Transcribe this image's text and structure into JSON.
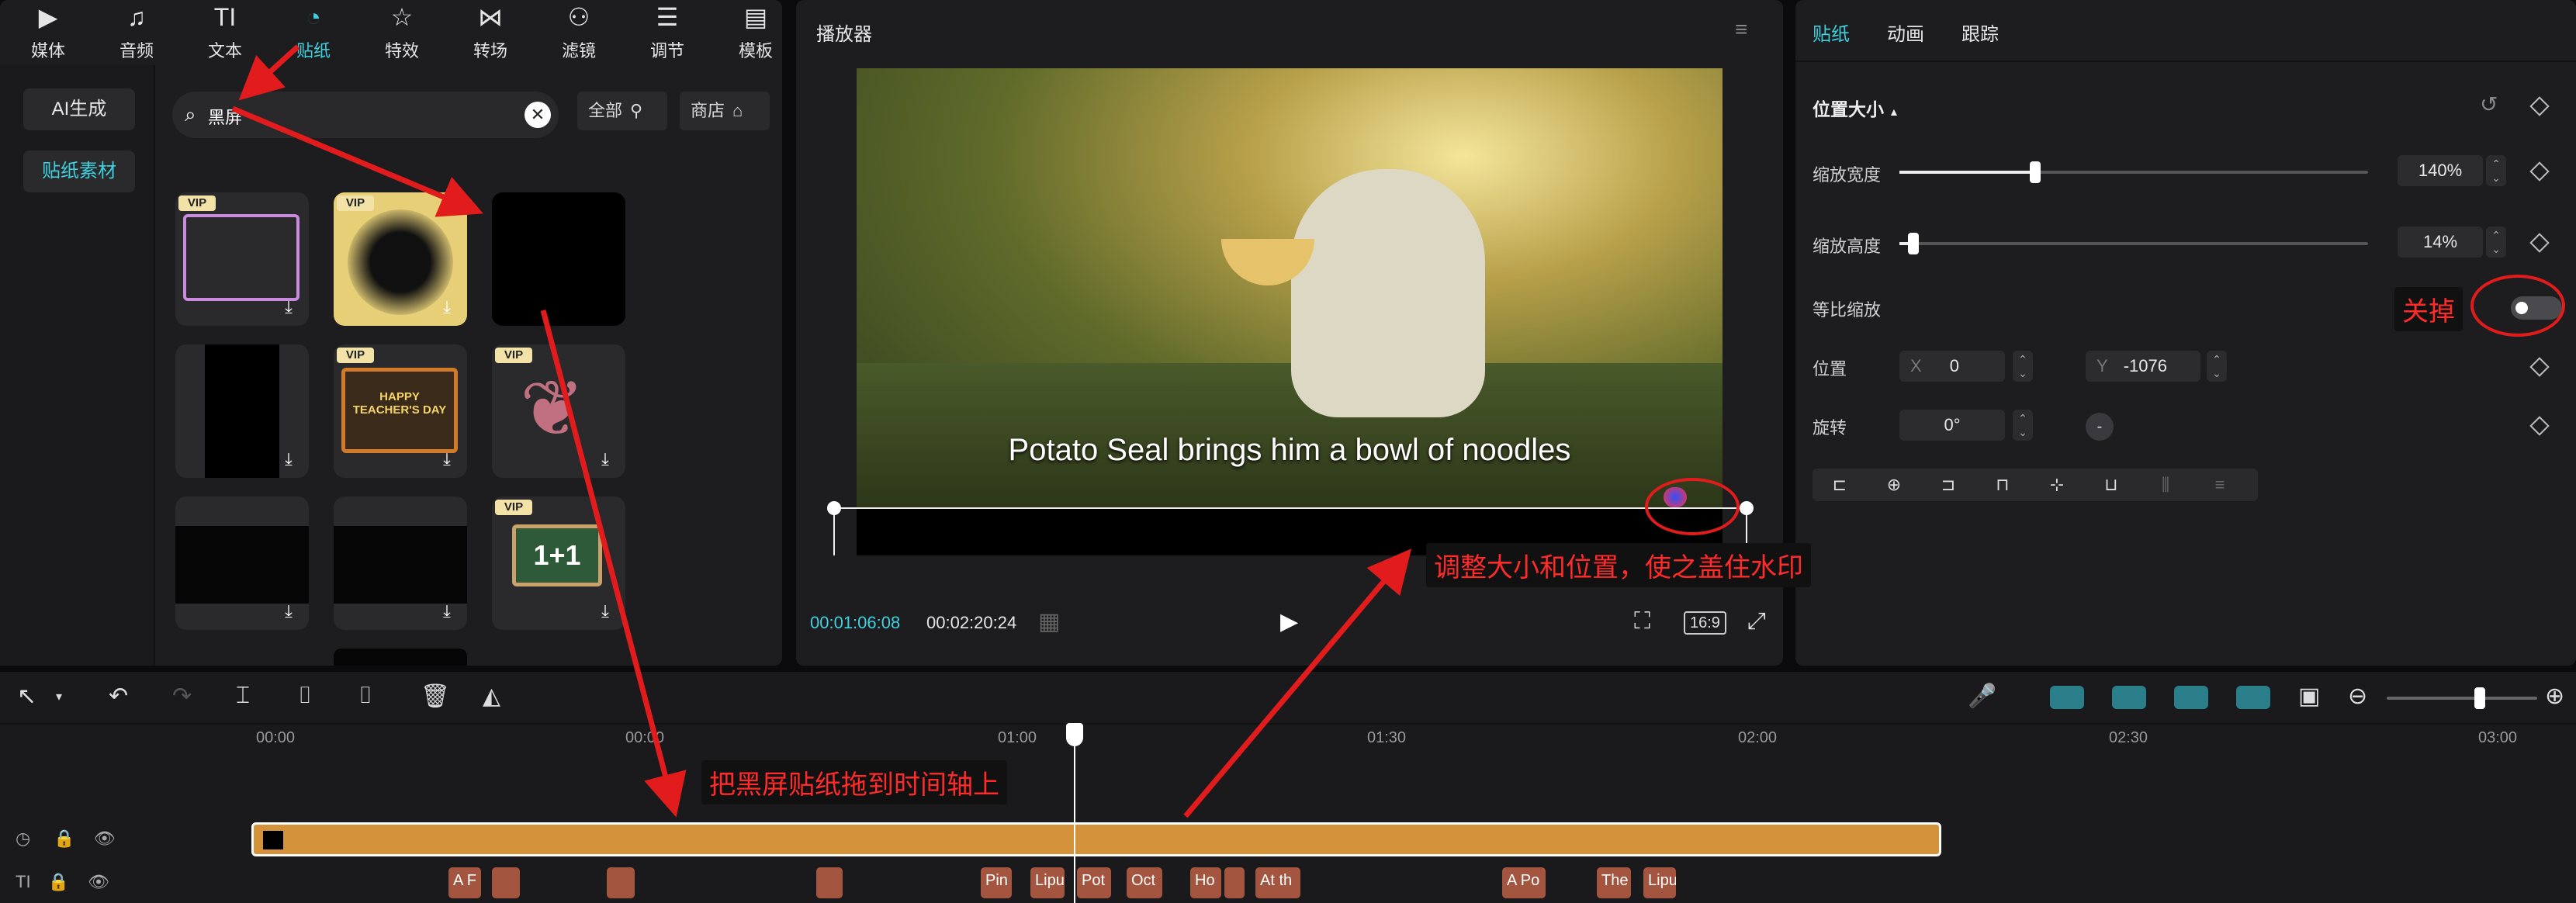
{
  "menu": [
    "媒体",
    "音频",
    "文本",
    "贴纸",
    "特效",
    "转场",
    "滤镜",
    "调节",
    "模板"
  ],
  "menu_icons": [
    "media-icon",
    "audio-icon",
    "text-icon",
    "sticker-icon",
    "effect-icon",
    "transition-icon",
    "filter-icon",
    "adjust-icon",
    "template-icon"
  ],
  "sidebar": {
    "ai_gen": "AI生成",
    "sticker_material": "贴纸素材"
  },
  "search": {
    "value": "黑屏"
  },
  "filter": {
    "all": "全部",
    "store": "商店"
  },
  "stickers": {
    "vip": "VIP",
    "happy_teachers": "HAPPY TEACHER'S DAY",
    "math": "1+1"
  },
  "player": {
    "title": "播放器",
    "subtitle": "Potato Seal brings him a bowl of noodles",
    "time_current": "00:01:06:08",
    "time_total": "00:02:20:24",
    "ratio": "16:9"
  },
  "props": {
    "tabs": [
      "贴纸",
      "动画",
      "跟踪"
    ],
    "section": "位置大小",
    "scale_width_label": "缩放宽度",
    "scale_width_value": "140%",
    "scale_width_level": 0.29,
    "scale_height_label": "缩放高度",
    "scale_height_value": "14%",
    "scale_height_level": 0.03,
    "uniform_label": "等比缩放",
    "position_label": "位置",
    "x_label": "X",
    "x_value": "0",
    "y_label": "Y",
    "y_value": "-1076",
    "rotate_label": "旋转",
    "rotate_value": "0°"
  },
  "timeline": {
    "ticks": [
      "00:00",
      "00:00",
      "01:00",
      "01:30",
      "02:00",
      "02:30",
      "03:00"
    ],
    "clips": [
      "A F",
      "",
      "",
      "",
      "Pin",
      "Lipu",
      "Pot",
      "Oct",
      "Ho",
      "",
      "At th",
      "A Po",
      "The",
      "Lipu"
    ],
    "zoom_level": 0.62
  },
  "annotations": {
    "close": "关掉",
    "adjust": "调整大小和位置，使之盖住水印",
    "drag": "把黑屏贴纸拖到时间轴上"
  },
  "colors": {
    "accent": "#3fd0e0",
    "track": "#d4923b",
    "annotation": "#ff2a2a"
  }
}
